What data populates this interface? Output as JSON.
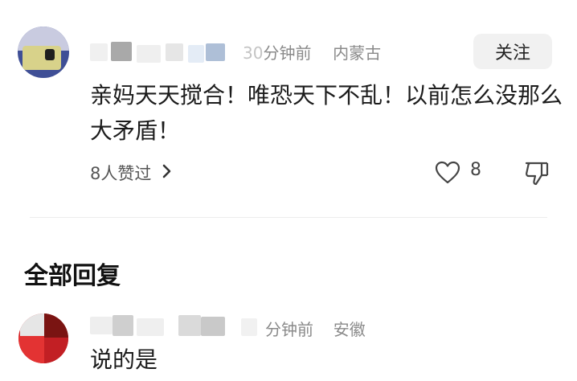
{
  "comment": {
    "author_obscured": true,
    "time": "分钟前",
    "time_prefix_partial": "30",
    "location": "内蒙古",
    "follow_label": "关注",
    "text": "亲妈天天搅合！唯恐天下不乱！以前怎么没那么大矛盾！",
    "likes_summary": "8人赞过",
    "like_count": "8"
  },
  "replies_section": {
    "title": "全部回复"
  },
  "reply": {
    "author_obscured": true,
    "time": "分钟前",
    "location": "安徽",
    "text": "说的是"
  },
  "icons": {
    "chevron": "chevron-right-icon",
    "like": "heart-outline-icon",
    "dislike": "thumbs-down-icon"
  }
}
